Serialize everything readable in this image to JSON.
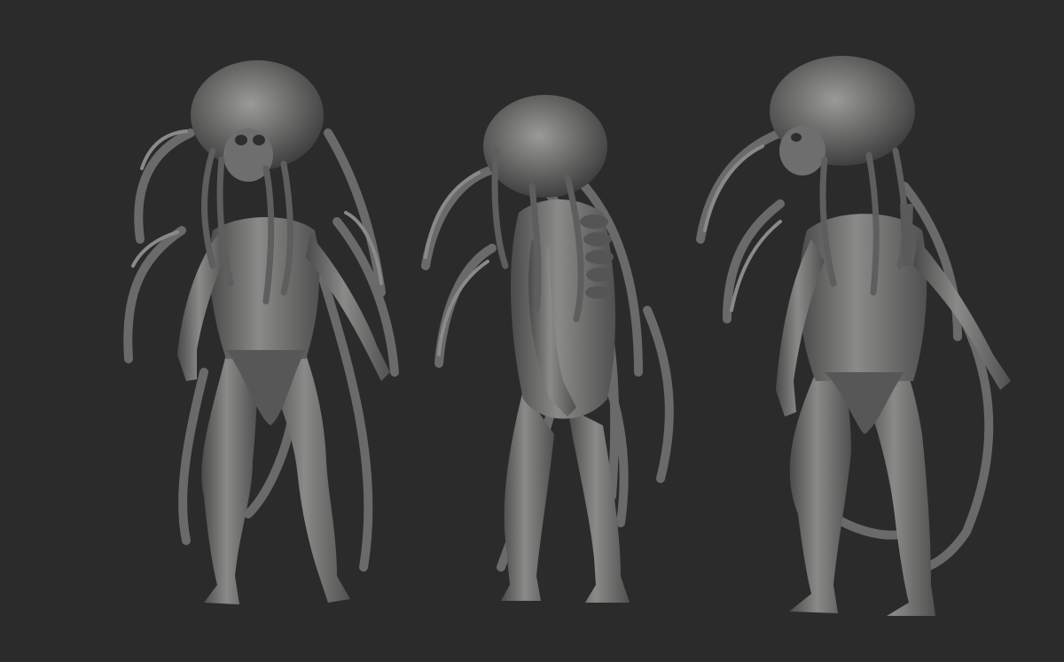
{
  "scene": {
    "background_color": "#2b2b2b",
    "clay_color": "#6b6b6b",
    "clay_highlight": "#9a9a98",
    "clay_shadow": "#3c3c3c",
    "views": [
      {
        "name": "front",
        "pose": "front-view"
      },
      {
        "name": "side",
        "pose": "side-view"
      },
      {
        "name": "three-quarter",
        "pose": "three-quarter-view"
      }
    ]
  }
}
